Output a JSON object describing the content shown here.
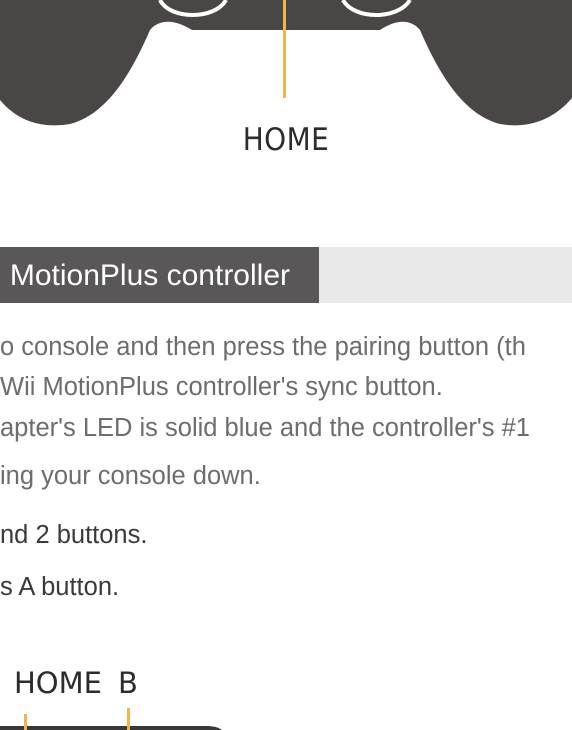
{
  "top_diagram": {
    "home_label": "HOME"
  },
  "section": {
    "title": "MotionPlus controller"
  },
  "instructions": [
    "o console and then press the pairing button (th",
    "Wii MotionPlus controller's sync button.",
    "apter's LED is solid blue and the controller's #1",
    "ing your console down.",
    "nd 2 buttons.",
    "s A button."
  ],
  "bottom_diagram": {
    "home_label": "HOME",
    "b_label": "B"
  },
  "colors": {
    "controller": "#4a4646",
    "leader_line": "#f0b648",
    "section_tab": "#5a5758",
    "section_bar": "#e8e8e8",
    "body_text": "#6e6c6c"
  }
}
